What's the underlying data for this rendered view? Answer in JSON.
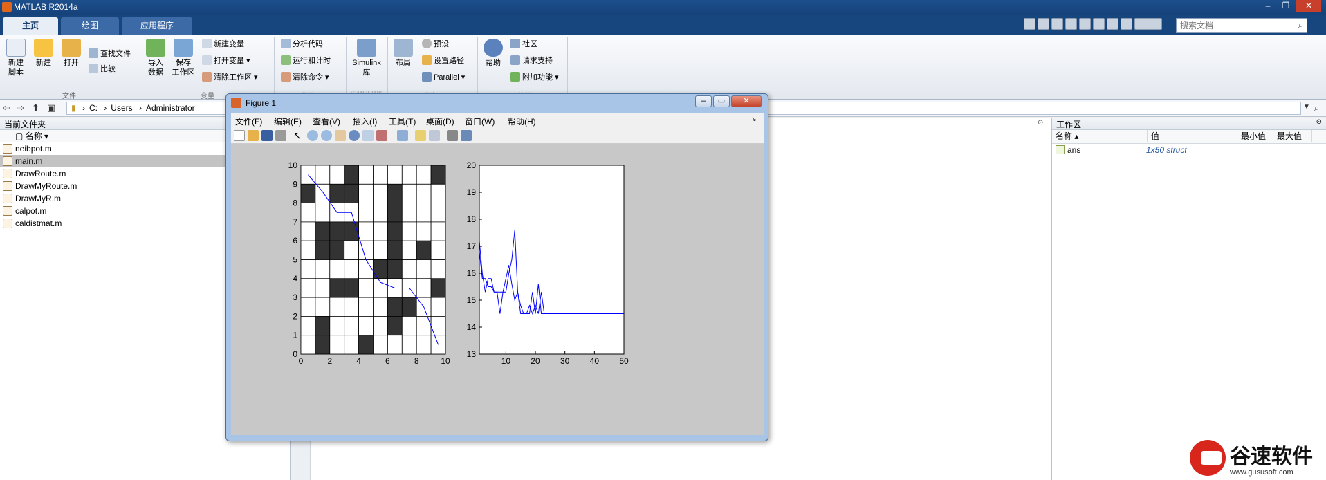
{
  "window": {
    "title": "MATLAB R2014a",
    "min": "–",
    "max": "❐",
    "close": "✕"
  },
  "tabs": [
    {
      "label": "主页"
    },
    {
      "label": "绘图"
    },
    {
      "label": "应用程序"
    }
  ],
  "search": {
    "placeholder": "搜索文档"
  },
  "ribbon": {
    "new_script": "新建\n脚本",
    "new": "新建",
    "open": "打开",
    "find_files": "查找文件",
    "compare": "比较",
    "import": "导入\n数据",
    "save_ws": "保存\n工作区",
    "new_var": "新建变量",
    "open_var": "打开变量 ▾",
    "clear_ws": "清除工作区 ▾",
    "analyze": "分析代码",
    "run_time": "运行和计时",
    "clear_cmd": "清除命令 ▾",
    "simulink": "Simulink\n库",
    "layout": "布局",
    "prefs": "预设",
    "set_path": "设置路径",
    "parallel": "Parallel ▾",
    "help": "帮助",
    "community": "社区",
    "request_support": "请求支持",
    "addons": "附加功能 ▾",
    "group_file": "文件",
    "group_var": "变量",
    "group_code": "代码",
    "group_sim": "SIMULINK",
    "group_env": "环境",
    "group_res": "资源"
  },
  "address": {
    "path": [
      "C:",
      "Users",
      "Administrator"
    ]
  },
  "current_folder": {
    "title": "当前文件夹",
    "col_name": "名称 ▾",
    "files": [
      "neibpot.m",
      "main.m",
      "DrawRoute.m",
      "DrawMyRoute.m",
      "DrawMyR.m",
      "calpot.m",
      "caldistmat.m"
    ],
    "selected": 1
  },
  "workspace": {
    "title": "工作区",
    "cols": [
      "名称 ▴",
      "值",
      "最小值",
      "最大值"
    ],
    "rows": [
      {
        "name": "ans",
        "value": "1x50 struct"
      }
    ]
  },
  "figure": {
    "title": "Figure 1",
    "menu": [
      "文件(F)",
      "编辑(E)",
      "查看(V)",
      "插入(I)",
      "工具(T)",
      "桌面(D)",
      "窗口(W)",
      "帮助(H)"
    ]
  },
  "chart_data": [
    {
      "type": "heatmap",
      "title": "",
      "xlabel": "",
      "ylabel": "",
      "xlim": [
        0,
        10
      ],
      "ylim": [
        0,
        10
      ],
      "xticks": [
        0,
        2,
        4,
        6,
        8,
        10
      ],
      "yticks": [
        0,
        1,
        2,
        3,
        4,
        5,
        6,
        7,
        8,
        9,
        10
      ],
      "grid_rows_top_to_bottom": [
        [
          0,
          0,
          0,
          1,
          0,
          0,
          0,
          0,
          0,
          1
        ],
        [
          1,
          0,
          1,
          1,
          0,
          0,
          1,
          0,
          0,
          0
        ],
        [
          0,
          0,
          0,
          0,
          0,
          0,
          1,
          0,
          0,
          0
        ],
        [
          0,
          1,
          1,
          1,
          0,
          0,
          1,
          0,
          0,
          0
        ],
        [
          0,
          1,
          1,
          0,
          0,
          0,
          1,
          0,
          1,
          0
        ],
        [
          0,
          0,
          0,
          0,
          0,
          1,
          1,
          0,
          0,
          0
        ],
        [
          0,
          0,
          1,
          1,
          0,
          0,
          0,
          0,
          0,
          1
        ],
        [
          0,
          0,
          0,
          0,
          0,
          0,
          1,
          1,
          0,
          0
        ],
        [
          0,
          1,
          0,
          0,
          0,
          0,
          1,
          0,
          0,
          0
        ],
        [
          0,
          1,
          0,
          0,
          1,
          0,
          0,
          0,
          0,
          0
        ]
      ],
      "route": {
        "x": [
          0.5,
          1.5,
          2.5,
          3.5,
          4.5,
          5.5,
          6.5,
          7.5,
          8.5,
          9.5
        ],
        "y": [
          9.5,
          8.6,
          7.5,
          7.5,
          5.0,
          3.8,
          3.5,
          3.5,
          2.5,
          0.5
        ]
      }
    },
    {
      "type": "line",
      "title": "",
      "xlabel": "",
      "ylabel": "",
      "xlim": [
        1,
        50
      ],
      "ylim": [
        13,
        20
      ],
      "xticks": [
        10,
        20,
        30,
        40,
        50
      ],
      "yticks": [
        13,
        14,
        15,
        16,
        17,
        18,
        19,
        20
      ],
      "series": [
        {
          "x": [
            1,
            2,
            3,
            4,
            5,
            6,
            7,
            8,
            9,
            10,
            11,
            12,
            13,
            14,
            15,
            16,
            17,
            18,
            19,
            20,
            21,
            22,
            23,
            24,
            25,
            26,
            27,
            28,
            29,
            30,
            31,
            32,
            33,
            34,
            35,
            36,
            37,
            38,
            39,
            40,
            41,
            42,
            43,
            44,
            45,
            46,
            47,
            48,
            49,
            50
          ],
          "y": [
            17.2,
            16.0,
            15.3,
            15.8,
            15.8,
            15.3,
            15.3,
            14.5,
            15.3,
            15.3,
            16.0,
            16.5,
            17.6,
            15.3,
            14.5,
            14.5,
            14.5,
            14.5,
            15.3,
            14.5,
            15.6,
            14.5,
            14.5,
            14.5,
            14.5,
            14.5,
            14.5,
            14.5,
            14.5,
            14.5,
            14.5,
            14.5,
            14.5,
            14.5,
            14.5,
            14.5,
            14.5,
            14.5,
            14.5,
            14.5,
            14.5,
            14.5,
            14.5,
            14.5,
            14.5,
            14.5,
            14.5,
            14.5,
            14.5,
            14.5
          ]
        },
        {
          "x": [
            1,
            2,
            3,
            4,
            5,
            6,
            7,
            8,
            9,
            10,
            11,
            12,
            13,
            14,
            15,
            16,
            17,
            18,
            19,
            20,
            21,
            22,
            23,
            24,
            25,
            26,
            27,
            28,
            29,
            30,
            31,
            32,
            33,
            34,
            35,
            36,
            37,
            38,
            39,
            40,
            41,
            42,
            43,
            44,
            45,
            46,
            47,
            48,
            49,
            50
          ],
          "y": [
            16.8,
            15.8,
            15.8,
            15.5,
            15.5,
            15.3,
            15.3,
            15.3,
            15.3,
            15.8,
            16.3,
            15.6,
            15.0,
            15.3,
            14.8,
            14.5,
            14.5,
            14.8,
            14.5,
            14.8,
            14.5,
            15.3,
            14.5,
            14.5,
            14.5,
            14.5,
            14.5,
            14.5,
            14.5,
            14.5,
            14.5,
            14.5,
            14.5,
            14.5,
            14.5,
            14.5,
            14.5,
            14.5,
            14.5,
            14.5,
            14.5,
            14.5,
            14.5,
            14.5,
            14.5,
            14.5,
            14.5,
            14.5,
            14.5,
            14.5
          ]
        }
      ]
    }
  ],
  "watermark": {
    "brand": "谷速软件",
    "url": "www.gususoft.com"
  },
  "colors": {
    "title_bar": "#17457e",
    "plot_line": "#0000ff",
    "obstacle": "#333333"
  }
}
